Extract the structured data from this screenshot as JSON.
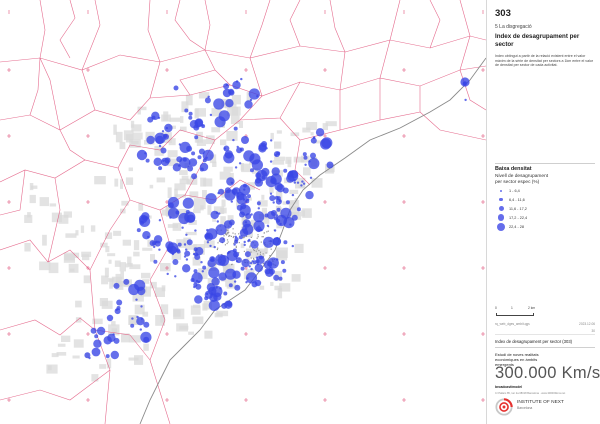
{
  "sheet": {
    "number": "303",
    "subtitle": "5 La disgregació",
    "title": "Index de desagrupament per sector",
    "description": "Index obtingut a partir de la relació existent entre el valor màxim de la sèrie de densitat per sectors a 1km entre el valor de densitat per sector de cada activitat."
  },
  "legend": {
    "title": "Baixa densitat",
    "subtitle": "Nivell de desagrupament per sector espec (%)",
    "classes": [
      {
        "label": "1 - 6,4",
        "value_min": 1,
        "value_max": 6.4
      },
      {
        "label": "6,4 - 11,6",
        "value_min": 6.4,
        "value_max": 11.6
      },
      {
        "label": "11,6 - 17,2",
        "value_min": 11.6,
        "value_max": 17.2
      },
      {
        "label": "17,2 - 22,4",
        "value_min": 17.2,
        "value_max": 22.4
      },
      {
        "label": "22,4 - 28",
        "value_min": 22.4,
        "value_max": 28
      }
    ],
    "symbol_color": "#3a46e6"
  },
  "scale": {
    "labels": [
      "0",
      "1",
      "2 km"
    ]
  },
  "meta": {
    "left": "rq_web_dges_ambit.qgs",
    "right": "2023.12.06",
    "index": "30"
  },
  "caption": "Index de desagrupament per sector (303)",
  "study": "Estudi de noves realitats econòmiques en àmbits emergents",
  "brand": {
    "name": "300.000 Km/s",
    "sub": "broadcast/model",
    "address": "C/ Pallars 85, 1er 2a 08018 Barcelona · www.300000kms.net"
  },
  "institute": {
    "name": "INSTITUTE OF NEXT",
    "city": "Barcelona"
  },
  "map": {
    "boundary_color": "#e0527a",
    "urban_color": "#d9d9d9",
    "coast_color": "#8a8a8a"
  }
}
